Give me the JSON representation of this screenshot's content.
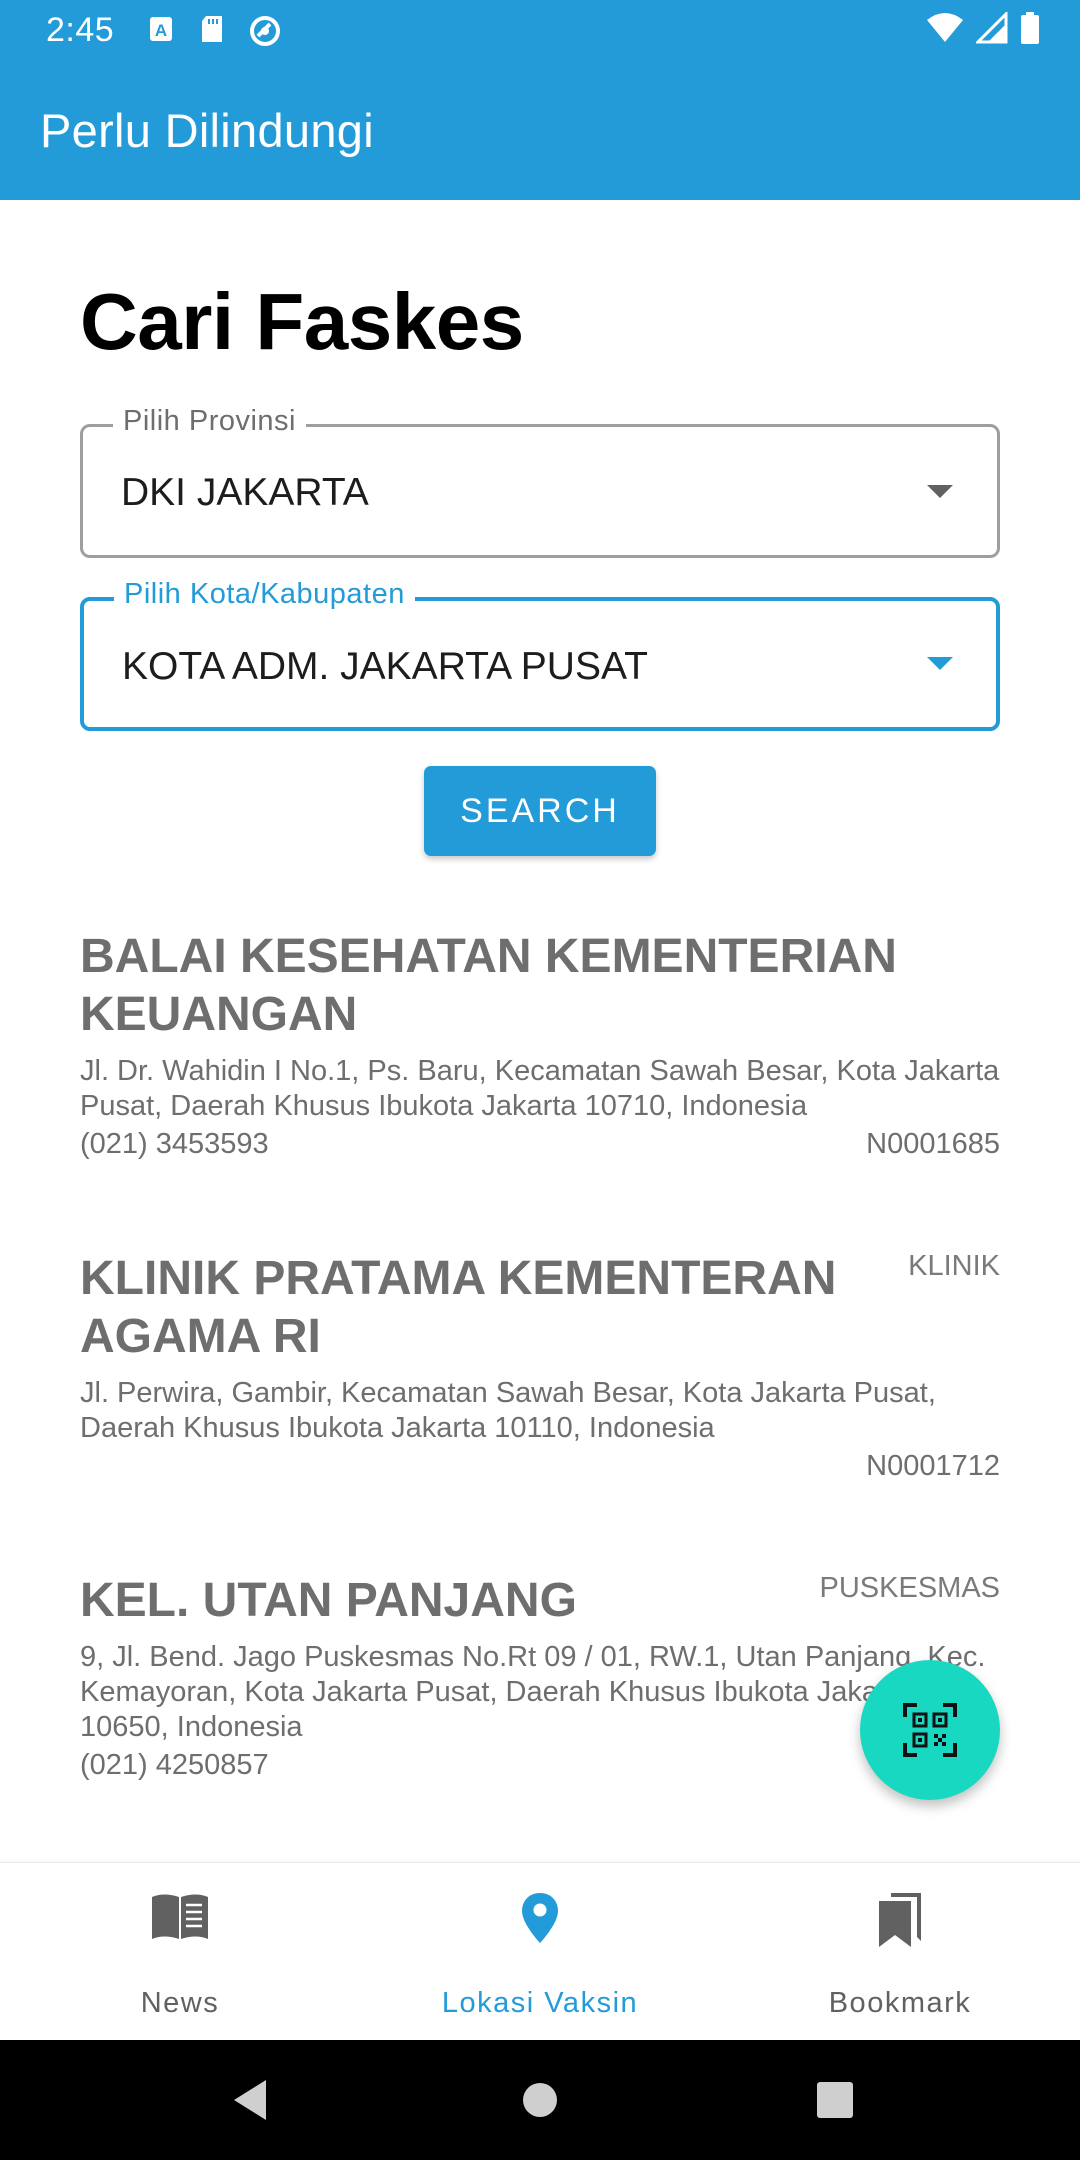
{
  "status_bar": {
    "time": "2:45",
    "left_icons": [
      "a-square-icon",
      "sd-card-icon",
      "sync-circle-icon"
    ],
    "right_icons": [
      "wifi-icon",
      "signal-icon",
      "battery-icon"
    ]
  },
  "app_bar": {
    "title": "Perlu Dilindungi"
  },
  "page": {
    "title": "Cari Faskes"
  },
  "province_select": {
    "label": "Pilih Provinsi",
    "value": "DKI JAKARTA"
  },
  "city_select": {
    "label": "Pilih Kota/Kabupaten",
    "value": "KOTA ADM. JAKARTA PUSAT"
  },
  "search_button": {
    "label": "SEARCH"
  },
  "facilities": [
    {
      "name": "BALAI KESEHATAN KEMENTERIAN KEUANGAN",
      "type": "",
      "address": "Jl. Dr. Wahidin I No.1, Ps. Baru, Kecamatan Sawah Besar, Kota Jakarta Pusat, Daerah Khusus Ibukota Jakarta 10710, Indonesia",
      "phone": "(021) 3453593",
      "code": "N0001685"
    },
    {
      "name": "KLINIK PRATAMA KEMENTERAN AGAMA RI",
      "type": "KLINIK",
      "address": "Jl. Perwira, Gambir, Kecamatan Sawah Besar, Kota Jakarta Pusat, Daerah Khusus Ibukota Jakarta 10110, Indonesia",
      "phone": "",
      "code": "N0001712"
    },
    {
      "name": "KEL. UTAN PANJANG",
      "type": "PUSKESMAS",
      "address": "9, Jl. Bend. Jago Puskesmas No.Rt 09 / 01, RW.1, Utan Panjang, Kec. Kemayoran, Kota Jakarta Pusat, Daerah Khusus Ibukota Jakarta 10650, Indonesia",
      "phone": "(021) 4250857",
      "code": ""
    }
  ],
  "fab": {
    "icon": "qr-code-scan-icon"
  },
  "bottom_nav": {
    "items": [
      {
        "label": "News",
        "icon": "book-icon",
        "active": false
      },
      {
        "label": "Lokasi Vaksin",
        "icon": "location-pin-icon",
        "active": true
      },
      {
        "label": "Bookmark",
        "icon": "bookmark-stack-icon",
        "active": false
      }
    ]
  },
  "colors": {
    "primary": "#229BD8",
    "fab": "#19D8C2",
    "muted_text": "#6e6e6e"
  }
}
